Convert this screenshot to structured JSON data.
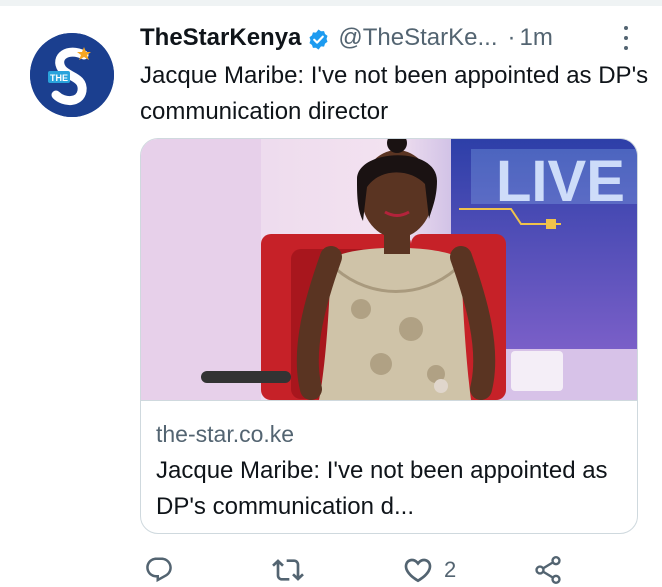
{
  "author": {
    "name": "TheStarKenya",
    "handle": "@TheStarKe...",
    "separator": "·",
    "time": "1m",
    "avatar_letters": "THE S"
  },
  "tweet": {
    "text": "Jacque Maribe: I've not been appointed as DP's communication director"
  },
  "card": {
    "image_text": "LIVE",
    "domain": "the-star.co.ke",
    "title": "Jacque Maribe: I've not been appointed as DP's communication d..."
  },
  "actions": {
    "reply_count": "",
    "retweet_count": "",
    "like_count": "2"
  },
  "colors": {
    "text": "#0f1419",
    "muted": "#536471",
    "verified": "#1d9bf0",
    "avatar_bg": "#1b3f8f",
    "border": "#cfd9de"
  },
  "icons": [
    "verified-badge-icon",
    "more-icon",
    "reply-icon",
    "retweet-icon",
    "like-icon",
    "share-icon"
  ]
}
